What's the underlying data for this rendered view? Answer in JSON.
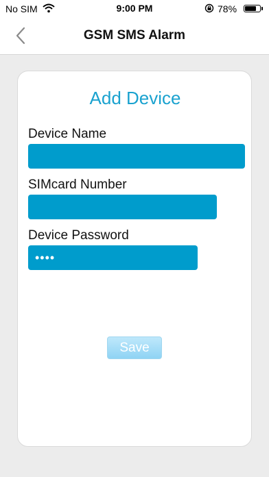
{
  "status_bar": {
    "carrier": "No SIM",
    "time": "9:00 PM",
    "battery_percent": "78%",
    "battery_level": 0.78
  },
  "nav": {
    "title": "GSM SMS Alarm",
    "back_icon": "chevron-left-icon"
  },
  "form": {
    "title": "Add Device",
    "device_name_label": "Device Name",
    "device_name_value": "",
    "sim_label": "SIMcard Number",
    "sim_value": "",
    "password_label": "Device Password",
    "password_value": "••••",
    "save_label": "Save"
  },
  "colors": {
    "accent": "#1aa2cf",
    "field_bg": "#009ccc",
    "background": "#ececec"
  }
}
